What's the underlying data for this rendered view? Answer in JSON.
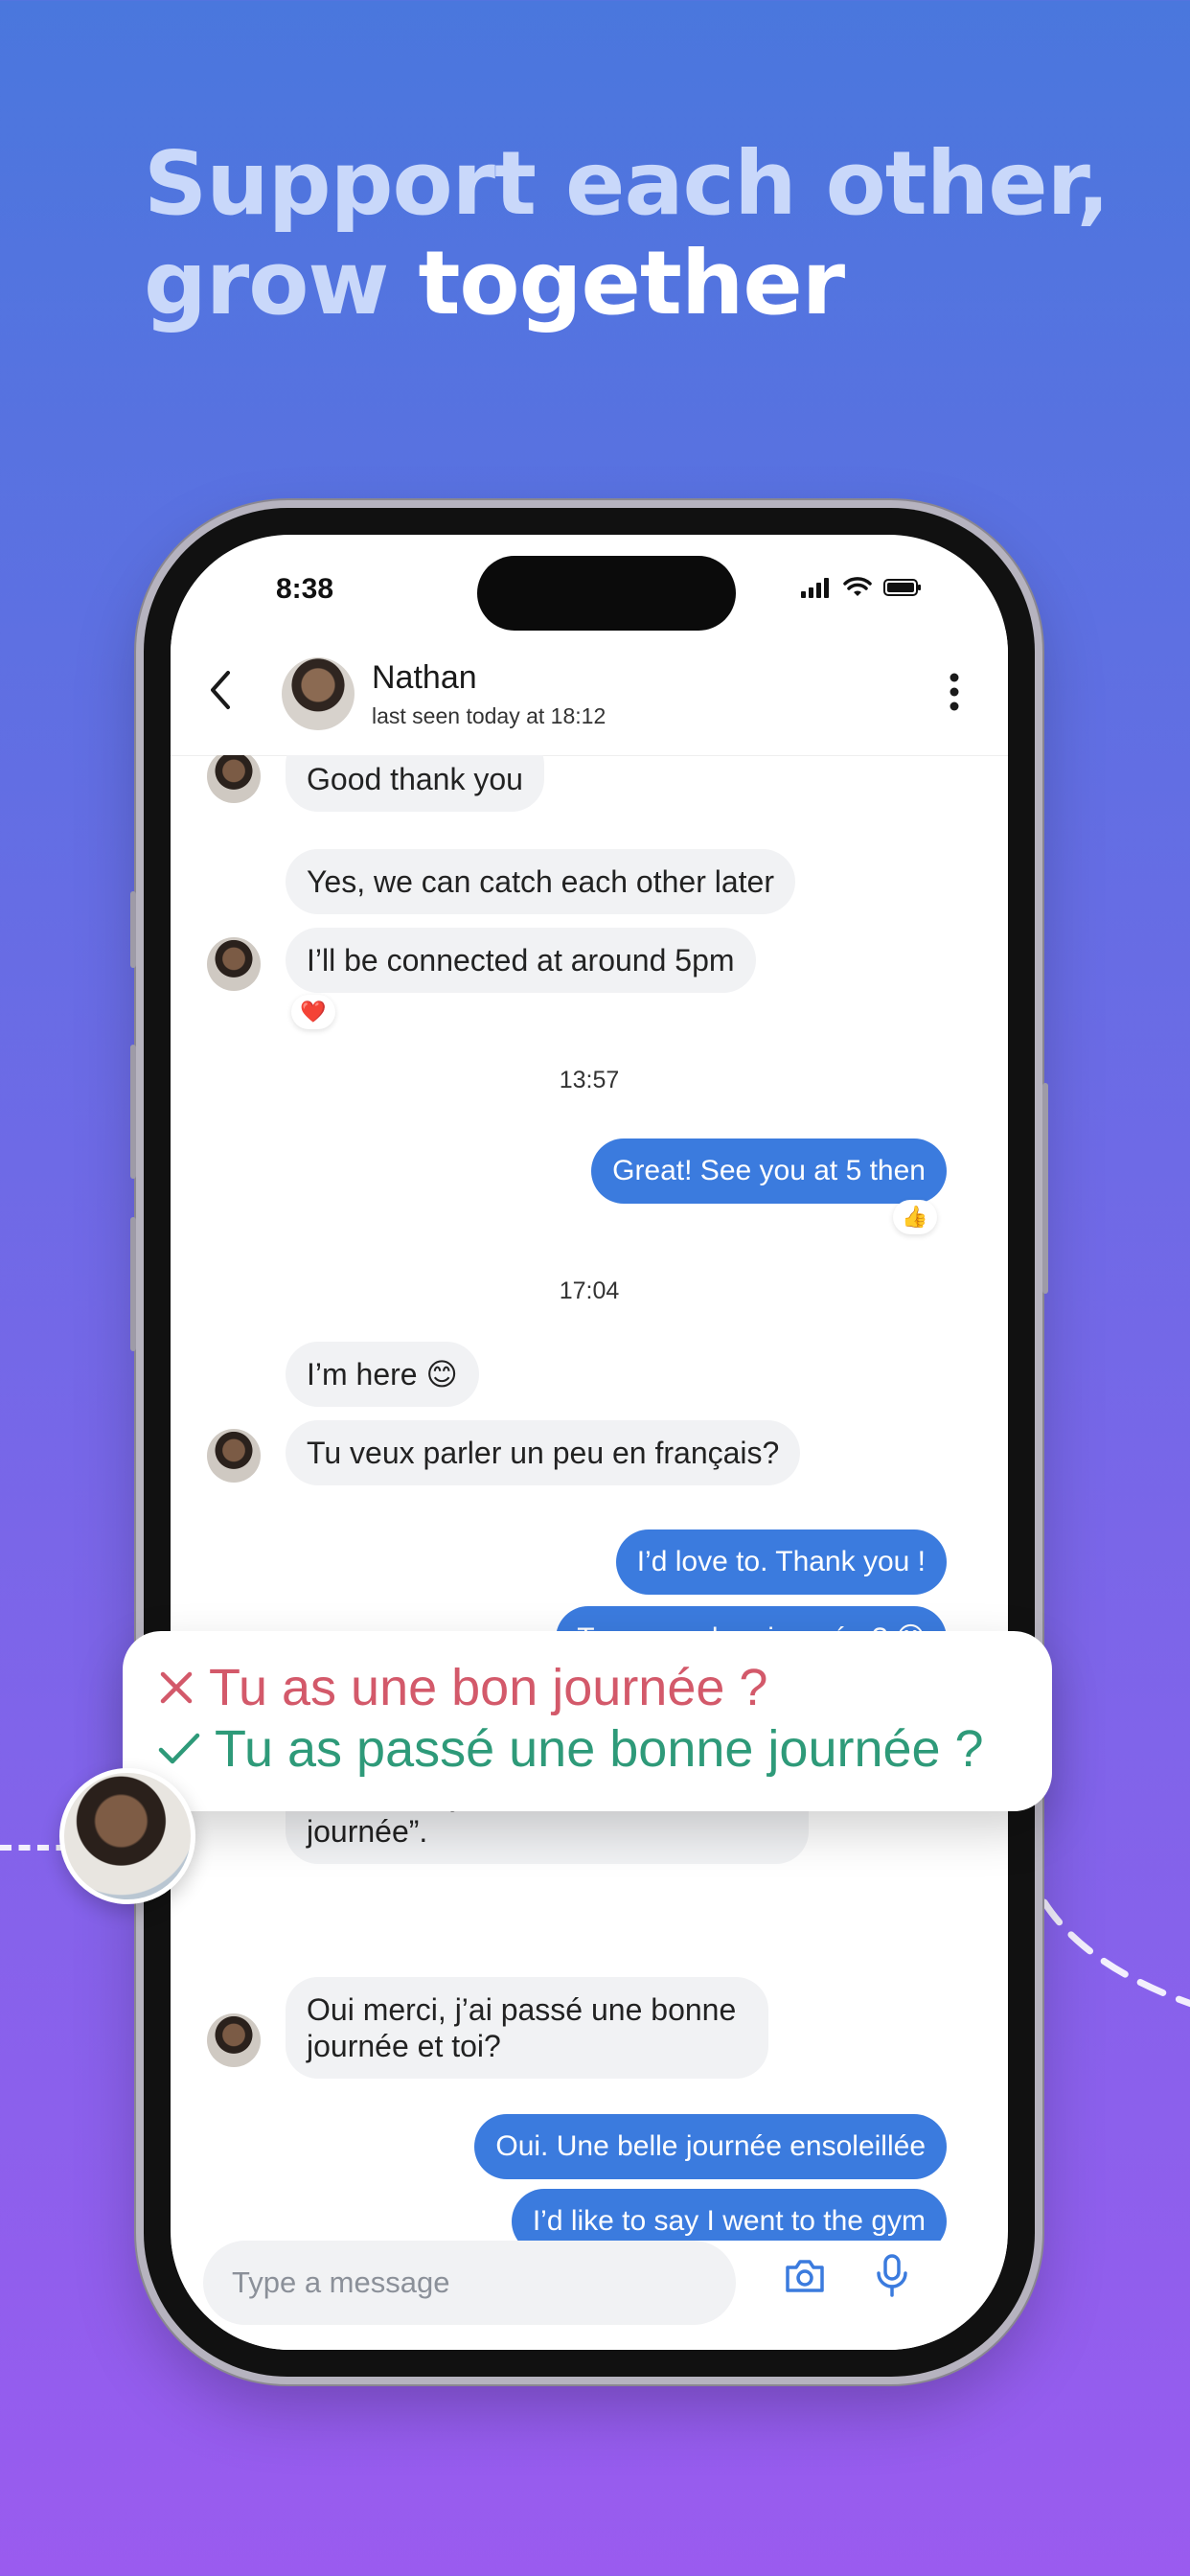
{
  "headline": {
    "line1": "Support each other,",
    "line2_prefix": "grow ",
    "line2_strong": "together"
  },
  "status_bar": {
    "time": "8:38"
  },
  "contact": {
    "name": "Nathan",
    "last_seen": "last seen today at 18:12"
  },
  "messages": {
    "m1": "Good thank you",
    "m2": "Yes, we can catch each other later",
    "m3": "I’ll be connected at around 5pm",
    "m3_reaction": "❤️",
    "time1": "13:57",
    "m4": "Great! See you at 5 then",
    "m4_reaction": "👍",
    "time2": "17:04",
    "m5": "I’m here 😊",
    "m6": "Tu veux parler un peu en français?",
    "m7": "I’d love to. Thank you !",
    "m8": "Tu as une bon journée ? 😊",
    "m9": "“bon” is “bonne” when it’s feminine. And we say “Passer une bonne journée”.",
    "m10": "Oui merci, j’ai passé une bonne journée et toi?",
    "m11": "Oui. Une belle journée ensoleillée",
    "m12": "I’d like to say I went to the gym"
  },
  "composer": {
    "placeholder": "Type a message"
  },
  "correction": {
    "wrong": "Tu as une bon journée ?",
    "right": "Tu as passé une bonne journée ?"
  },
  "colors": {
    "accent": "#3B7BDE",
    "wrong": "#D3596A",
    "right": "#2E9A79",
    "incoming_bubble": "#F1F2F4"
  }
}
